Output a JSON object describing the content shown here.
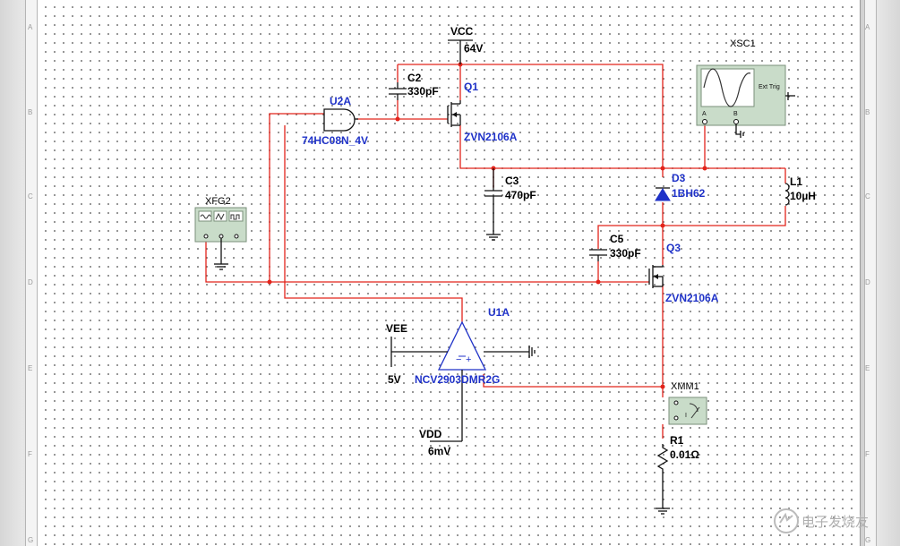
{
  "components": {
    "vcc": {
      "name": "VCC",
      "value": "64V"
    },
    "vee": {
      "name": "VEE",
      "value": "5V"
    },
    "vdd": {
      "name": "VDD",
      "value": "6mV"
    },
    "c2": {
      "name": "C2",
      "value": "330pF"
    },
    "c3": {
      "name": "C3",
      "value": "470pF"
    },
    "c5": {
      "name": "C5",
      "value": "330pF"
    },
    "q1": {
      "name": "Q1",
      "part": "ZVN2106A"
    },
    "q3": {
      "name": "Q3",
      "part": "ZVN2106A"
    },
    "u2a": {
      "name": "U2A",
      "part": "74HC08N_4V"
    },
    "u1a": {
      "name": "U1A",
      "part": "NCV2903DMR2G"
    },
    "d3": {
      "name": "D3",
      "part": "1BH62"
    },
    "l1": {
      "name": "L1",
      "value": "10µH"
    },
    "r1": {
      "name": "R1",
      "value": "0.01Ω"
    },
    "xfg2": {
      "name": "XFG2"
    },
    "xsc1": {
      "name": "XSC1",
      "ext_trig": "Ext Trig",
      "ch_a": "A",
      "ch_b": "B"
    },
    "xmm1": {
      "name": "XMM1"
    }
  },
  "ruler": {
    "rows": [
      "A",
      "B",
      "C",
      "D",
      "E",
      "F",
      "G"
    ]
  },
  "colors": {
    "wire": "#e2241b",
    "label_blue": "#1f32c8",
    "instrument": "#c9dcc9"
  },
  "watermark": {
    "text": "电子发烧友"
  }
}
